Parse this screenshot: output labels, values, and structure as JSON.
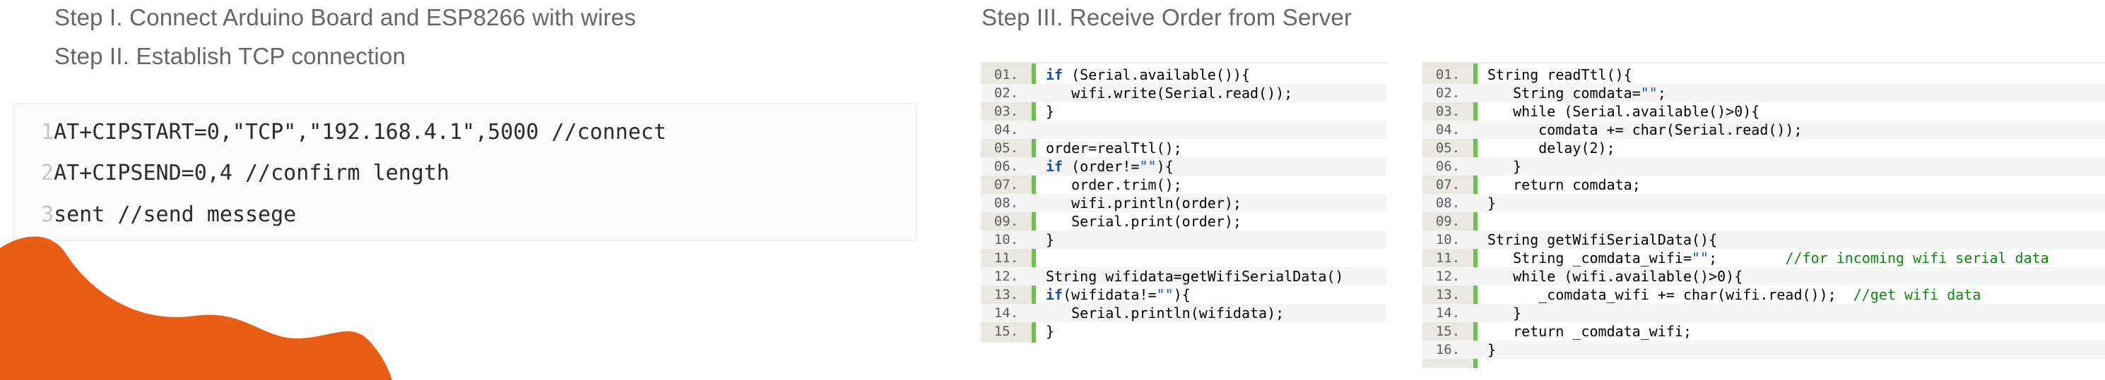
{
  "steps": {
    "step1": "Step I. Connect Arduino Board and ESP8266 with wires",
    "step2": "Step II. Establish TCP connection",
    "step3": "Step III. Receive Order from Server"
  },
  "colors": {
    "accent_orange": "#ea5d14",
    "gutter_bar": "#6cc24a",
    "keyword": "#1b4fa8",
    "comment": "#0a8a0a"
  },
  "command_block": {
    "lines": [
      {
        "num": "1",
        "text": "AT+CIPSTART=0,\"TCP\",\"192.168.4.1\",5000 //connect"
      },
      {
        "num": "2",
        "text": "AT+CIPSEND=0,4 //confirm length"
      },
      {
        "num": "3",
        "text": "sent //send messege"
      }
    ]
  },
  "code_left": {
    "lines": [
      {
        "n": "01.",
        "c": "if (Serial.available()){"
      },
      {
        "n": "02.",
        "c": "   wifi.write(Serial.read());"
      },
      {
        "n": "03.",
        "c": "}"
      },
      {
        "n": "04.",
        "c": ""
      },
      {
        "n": "05.",
        "c": "order=realTtl();"
      },
      {
        "n": "06.",
        "c": "if (order!=\"\"){"
      },
      {
        "n": "07.",
        "c": "   order.trim();"
      },
      {
        "n": "08.",
        "c": "   wifi.println(order);"
      },
      {
        "n": "09.",
        "c": "   Serial.print(order);"
      },
      {
        "n": "10.",
        "c": "}"
      },
      {
        "n": "11.",
        "c": ""
      },
      {
        "n": "12.",
        "c": "String wifidata=getWifiSerialData()"
      },
      {
        "n": "13.",
        "c": "if(wifidata!=\"\"){"
      },
      {
        "n": "14.",
        "c": "   Serial.println(wifidata);"
      },
      {
        "n": "15.",
        "c": "}"
      }
    ]
  },
  "code_right": {
    "lines": [
      {
        "n": "01.",
        "c": "String readTtl(){"
      },
      {
        "n": "02.",
        "c": "   String comdata=\"\";"
      },
      {
        "n": "03.",
        "c": "   while (Serial.available()>0){"
      },
      {
        "n": "04.",
        "c": "      comdata += char(Serial.read());"
      },
      {
        "n": "05.",
        "c": "      delay(2);"
      },
      {
        "n": "06.",
        "c": "   }"
      },
      {
        "n": "07.",
        "c": "   return comdata;"
      },
      {
        "n": "08.",
        "c": "}"
      },
      {
        "n": "09.",
        "c": ""
      },
      {
        "n": "10.",
        "c": "String getWifiSerialData(){"
      },
      {
        "n": "11.",
        "c": "   String _comdata_wifi=\"\";        //for incoming wifi serial data"
      },
      {
        "n": "12.",
        "c": "   while (wifi.available()>0){"
      },
      {
        "n": "13.",
        "c": "      _comdata_wifi += char(wifi.read());  //get wifi data"
      },
      {
        "n": "14.",
        "c": "   }"
      },
      {
        "n": "15.",
        "c": "   return _comdata_wifi;"
      },
      {
        "n": "16.",
        "c": "}"
      }
    ]
  }
}
